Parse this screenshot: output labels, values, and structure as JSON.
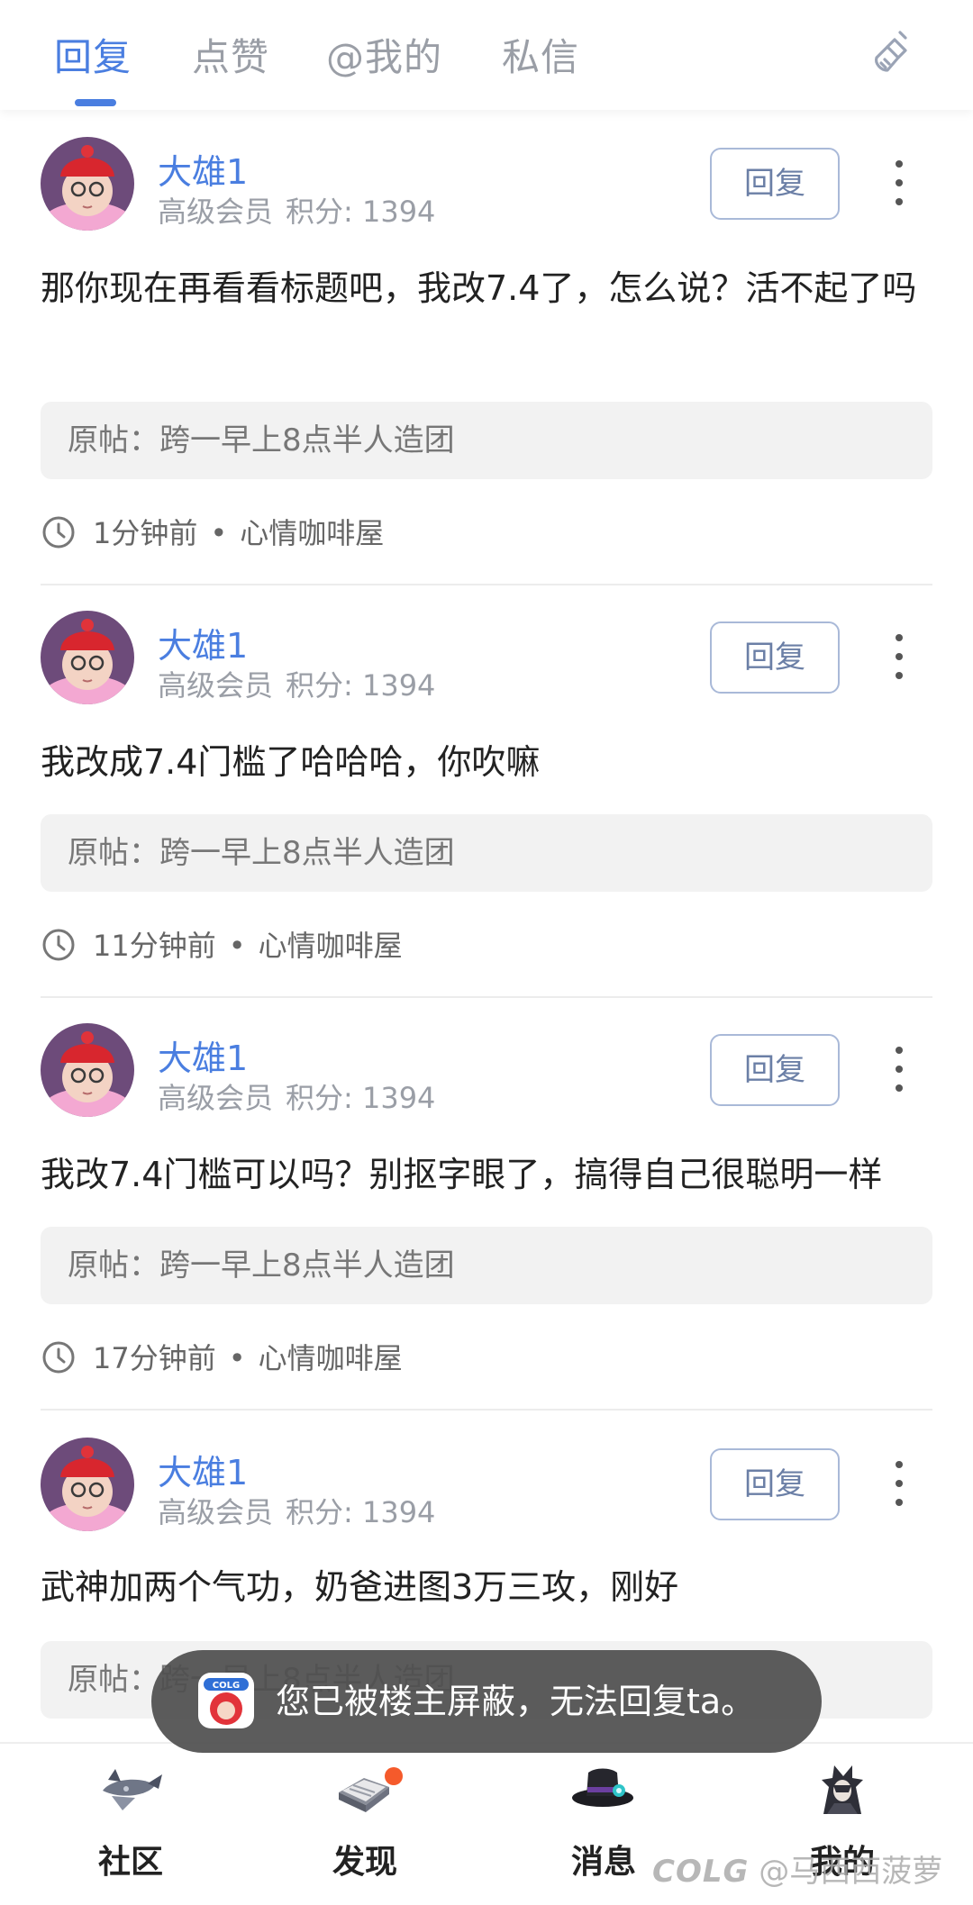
{
  "tabs": [
    {
      "label": "回复",
      "active": true
    },
    {
      "label": "点赞",
      "active": false
    },
    {
      "label": "@我的",
      "active": false
    },
    {
      "label": "私信",
      "active": false
    }
  ],
  "clear_icon": "broom-icon",
  "posts": [
    {
      "user": "大雄1",
      "level": "高级会员",
      "points_label": "积分: 1394",
      "reply_label": "回复",
      "content": "那你现在再看看标题吧，我改7.4了，怎么说？活不起了吗",
      "original_post": "原帖：跨一早上8点半人造团",
      "time": "1分钟前",
      "board": "心情咖啡屋"
    },
    {
      "user": "大雄1",
      "level": "高级会员",
      "points_label": "积分: 1394",
      "reply_label": "回复",
      "content": "我改成7.4门槛了哈哈哈，你吹嘛",
      "original_post": "原帖：跨一早上8点半人造团",
      "time": "11分钟前",
      "board": "心情咖啡屋"
    },
    {
      "user": "大雄1",
      "level": "高级会员",
      "points_label": "积分: 1394",
      "reply_label": "回复",
      "content": "我改7.4门槛可以吗？别抠字眼了，搞得自己很聪明一样",
      "original_post": "原帖：跨一早上8点半人造团",
      "time": "17分钟前",
      "board": "心情咖啡屋"
    },
    {
      "user": "大雄1",
      "level": "高级会员",
      "points_label": "积分: 1394",
      "reply_label": "回复",
      "content": "武神加两个气功，奶爸进图3万三攻，刚好",
      "original_post": "原帖：跨一早上8点半人造团",
      "time": "",
      "board": ""
    }
  ],
  "toast": {
    "icon_text": "COLG",
    "message": "您已被楼主屏蔽，无法回复ta。"
  },
  "bottom_nav": [
    {
      "label": "社区",
      "icon": "airship-icon",
      "active": false
    },
    {
      "label": "发现",
      "icon": "book-icon",
      "active": false,
      "badge": true
    },
    {
      "label": "消息",
      "icon": "top-hat-icon",
      "active": true
    },
    {
      "label": "我的",
      "icon": "character-avatar-icon",
      "active": false
    }
  ],
  "watermark": {
    "brand": "COLG",
    "handle": "@马西西菠萝"
  },
  "colors": {
    "accent": "#4a7ee0",
    "active_nav": "#f07a1a",
    "badge": "#f55a2b"
  }
}
